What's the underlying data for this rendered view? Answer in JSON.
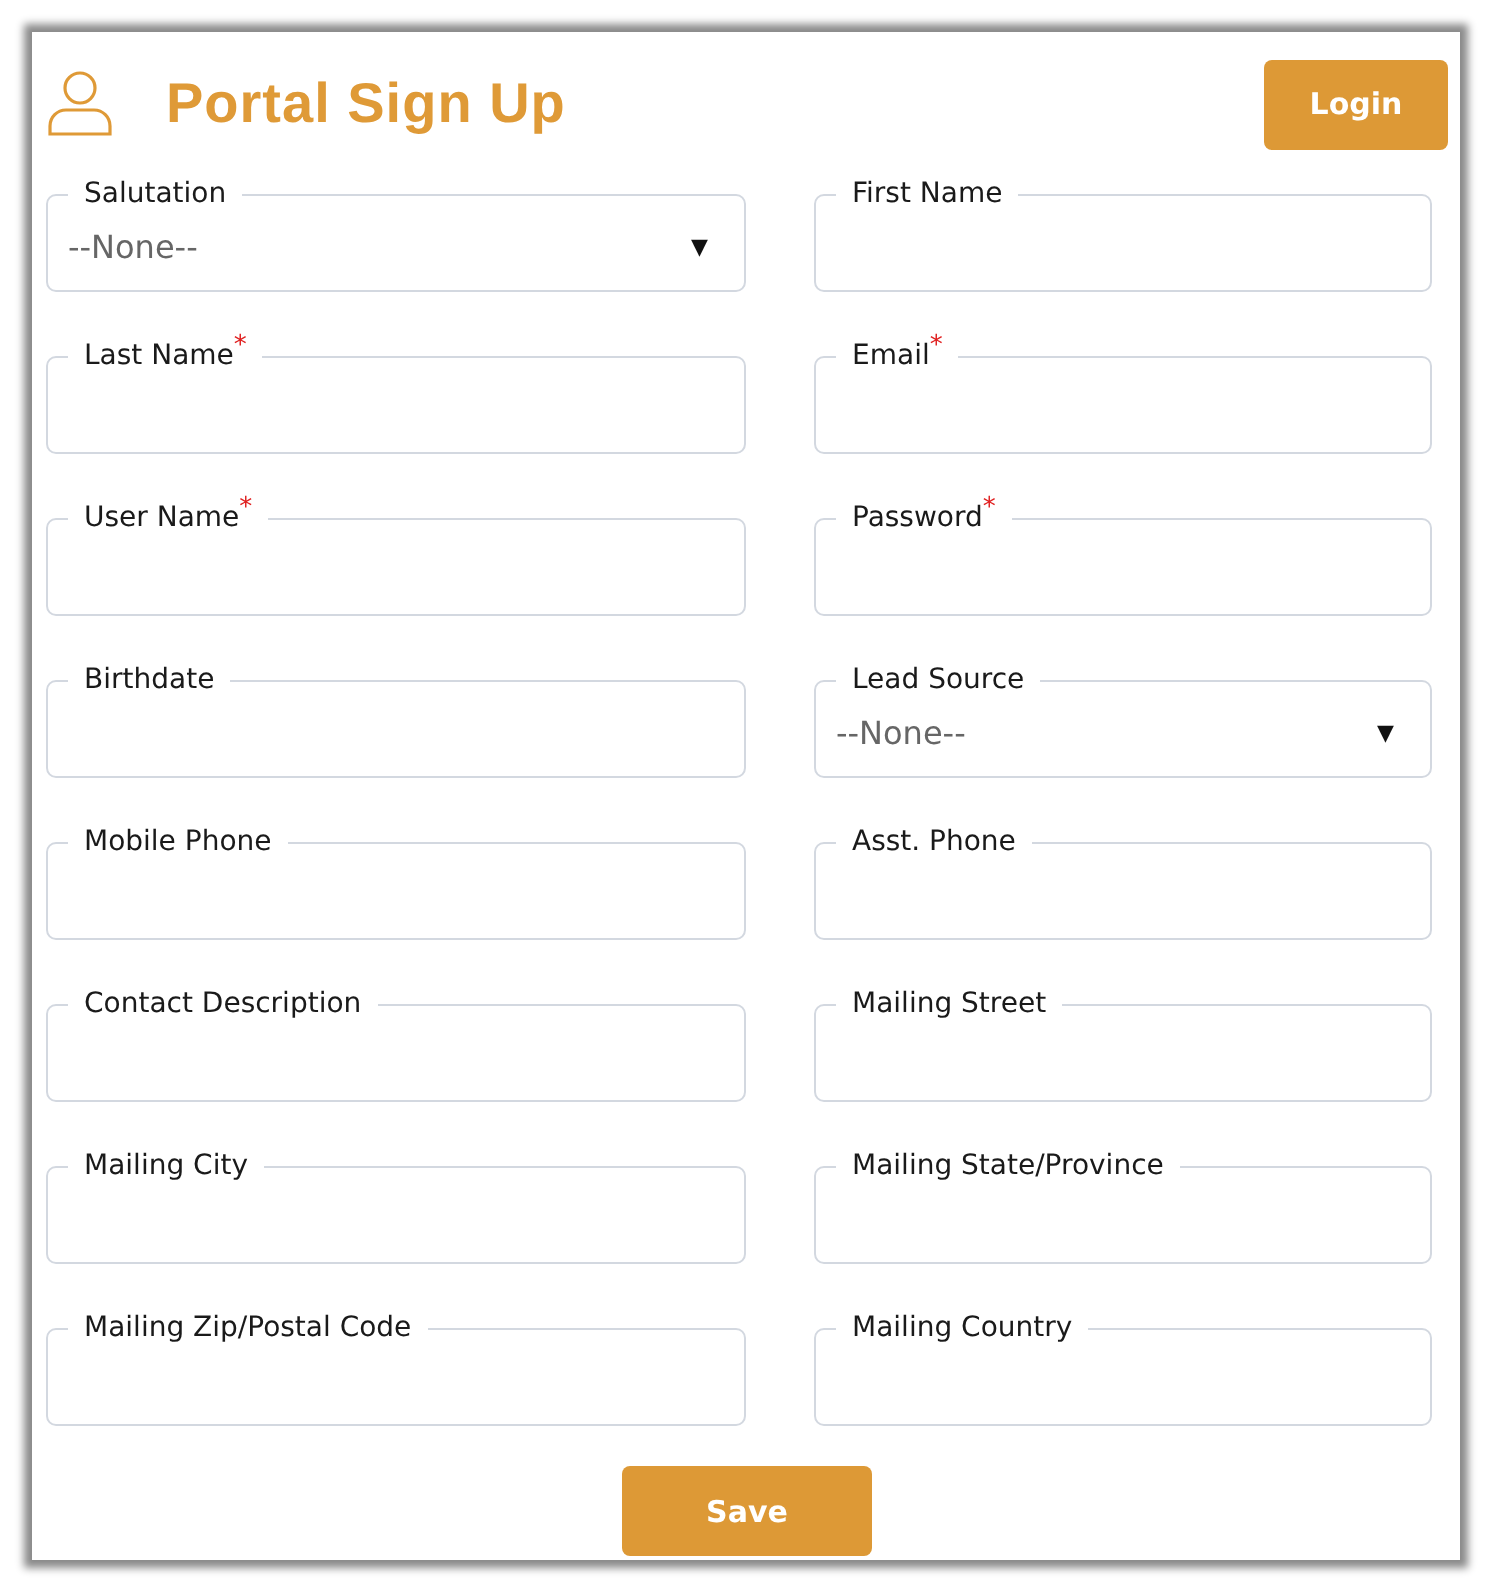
{
  "header": {
    "title": "Portal Sign Up",
    "login_button": "Login"
  },
  "fields": [
    {
      "label": "Salutation",
      "kind": "select",
      "value": "--None--",
      "arrow": "▼"
    },
    {
      "label": "First Name",
      "kind": "text"
    },
    {
      "label": "Last Name",
      "kind": "text",
      "required_mark": "*"
    },
    {
      "label": "Email",
      "kind": "text",
      "required_mark": "*"
    },
    {
      "label": "User Name",
      "kind": "text",
      "required_mark": "*"
    },
    {
      "label": "Password",
      "kind": "text",
      "required_mark": "*"
    },
    {
      "label": "Birthdate",
      "kind": "text"
    },
    {
      "label": "Lead Source",
      "kind": "select",
      "value": "--None--",
      "arrow": "▼"
    },
    {
      "label": "Mobile Phone",
      "kind": "text"
    },
    {
      "label": "Asst. Phone",
      "kind": "text"
    },
    {
      "label": "Contact Description",
      "kind": "text"
    },
    {
      "label": "Mailing Street",
      "kind": "text"
    },
    {
      "label": "Mailing City",
      "kind": "text"
    },
    {
      "label": "Mailing State/Province",
      "kind": "text"
    },
    {
      "label": "Mailing Zip/Postal Code",
      "kind": "text"
    },
    {
      "label": "Mailing Country",
      "kind": "text"
    }
  ],
  "save_button": "Save"
}
